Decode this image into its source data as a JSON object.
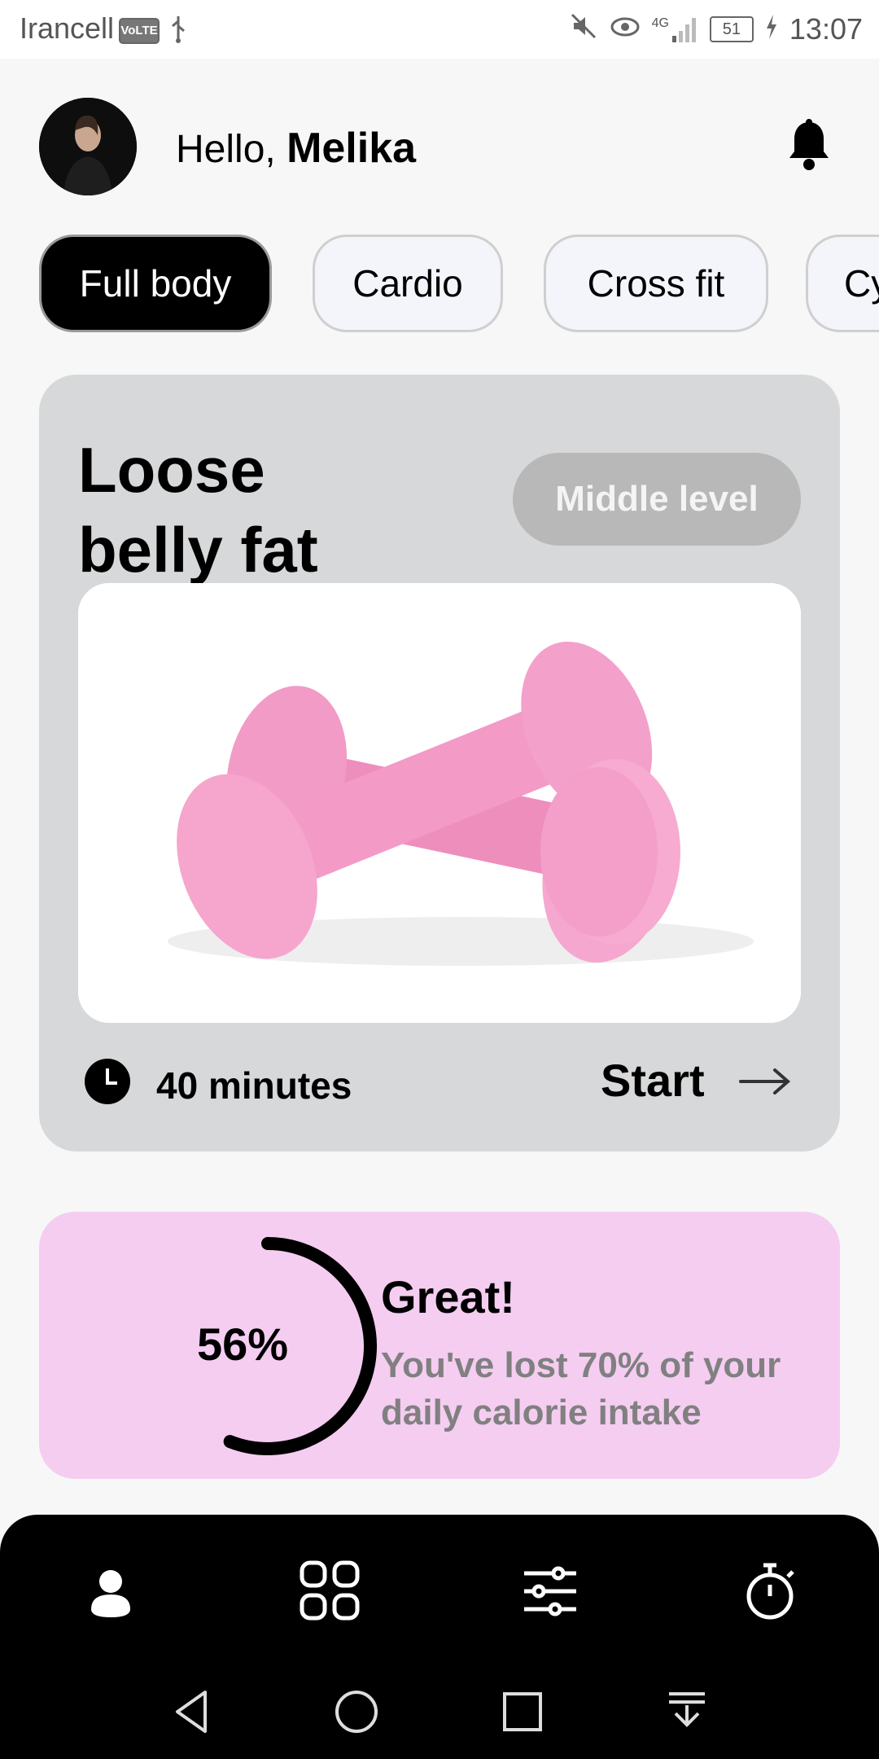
{
  "status_bar": {
    "carrier": "Irancell",
    "volte": "VoLTE",
    "network": "4G",
    "battery": "51",
    "time": "13:07"
  },
  "header": {
    "greeting": "Hello,",
    "user_name": "Melika"
  },
  "chips": [
    {
      "label": "Full body",
      "active": true
    },
    {
      "label": "Cardio",
      "active": false
    },
    {
      "label": "Cross fit",
      "active": false
    },
    {
      "label": "Cy",
      "active": false
    }
  ],
  "workout": {
    "title": "Loose belly fat",
    "level": "Middle level",
    "duration": "40 minutes",
    "start_label": "Start"
  },
  "progress": {
    "percent_label": "56%",
    "percent_value": 0.56,
    "headline": "Great!",
    "message": "You've lost 70% of your daily calorie intake"
  },
  "bottom_nav": {
    "items": [
      "profile-icon",
      "grid-icon",
      "sliders-icon",
      "stopwatch-icon"
    ]
  },
  "system_nav": [
    "back-icon",
    "home-icon",
    "recents-icon",
    "notification-pull-icon"
  ],
  "colors": {
    "accent_pink": "#f5cdf1",
    "card_gray": "#d6d8d9",
    "dumbbell_pink": "#f39ac6"
  }
}
